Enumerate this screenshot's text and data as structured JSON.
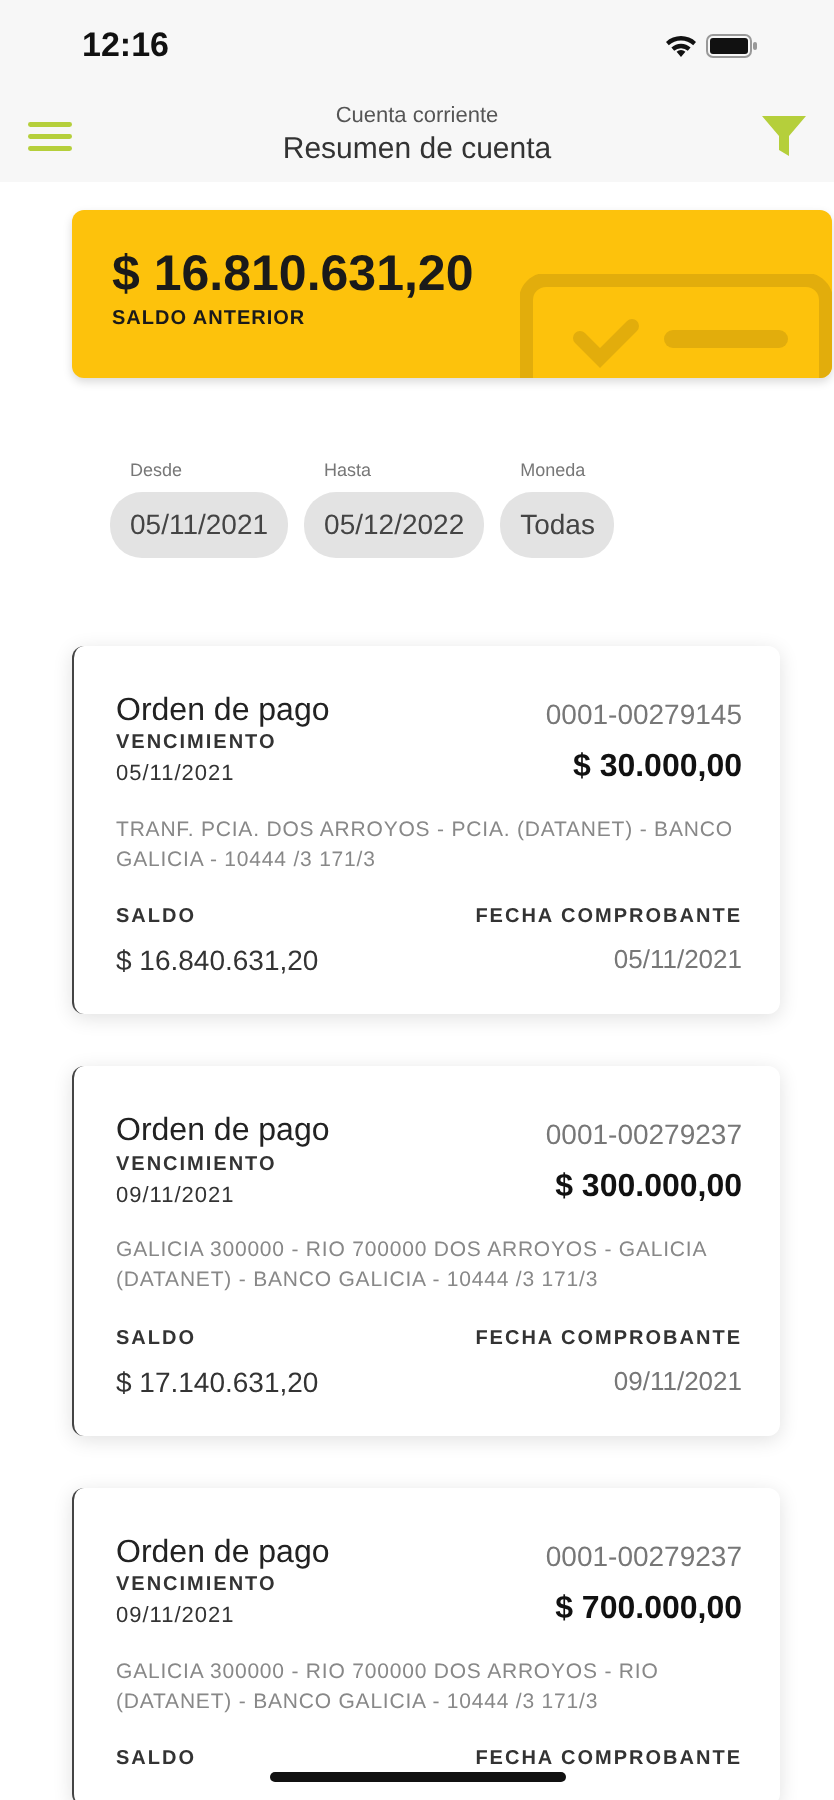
{
  "status_bar": {
    "time": "12:16"
  },
  "header": {
    "subtitle": "Cuenta corriente",
    "title": "Resumen de cuenta"
  },
  "balance": {
    "amount": "$ 16.810.631,20",
    "label": "SALDO ANTERIOR"
  },
  "filters": [
    {
      "label": "Desde",
      "value": "05/11/2021"
    },
    {
      "label": "Hasta",
      "value": "05/12/2022"
    },
    {
      "label": "Moneda",
      "value": "Todas"
    }
  ],
  "movements": [
    {
      "type": "Orden de pago",
      "number": "0001-00279145",
      "due_label": "VENCIMIENTO",
      "due_date": "05/11/2021",
      "amount": "$ 30.000,00",
      "description": "TRANF. PCIA. DOS ARROYOS - PCIA. (DATANET) - BANCO GALICIA - 10444 /3 171/3",
      "balance_label": "SALDO",
      "balance": "$ 16.840.631,20",
      "date_label": "FECHA COMPROBANTE",
      "date": "05/11/2021"
    },
    {
      "type": "Orden de pago",
      "number": "0001-00279237",
      "due_label": "VENCIMIENTO",
      "due_date": "09/11/2021",
      "amount": "$ 300.000,00",
      "description": "GALICIA 300000 - RIO 700000 DOS ARROYOS - GALICIA (DATANET) - BANCO GALICIA - 10444 /3 171/3",
      "balance_label": "SALDO",
      "balance": "$ 17.140.631,20",
      "date_label": "FECHA COMPROBANTE",
      "date": "09/11/2021"
    },
    {
      "type": "Orden de pago",
      "number": "0001-00279237",
      "due_label": "VENCIMIENTO",
      "due_date": "09/11/2021",
      "amount": "$ 700.000,00",
      "description": "GALICIA 300000 - RIO 700000 DOS ARROYOS - RIO (DATANET) - BANCO GALICIA - 10444 /3 171/3",
      "balance_label": "SALDO",
      "date_label": "FECHA COMPROBANTE"
    }
  ]
}
